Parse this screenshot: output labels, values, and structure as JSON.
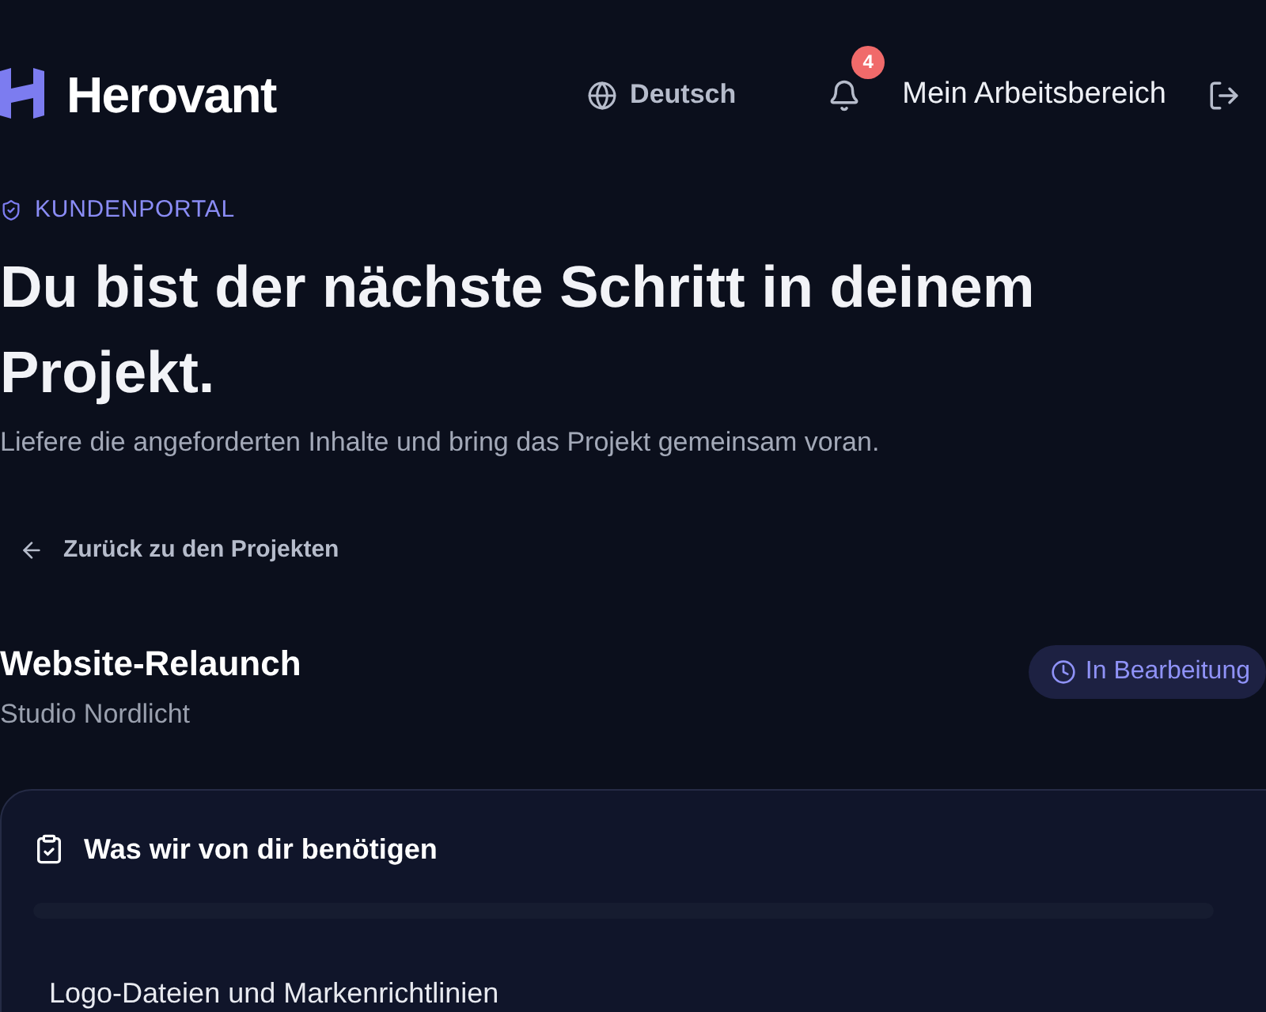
{
  "header": {
    "brand": "Herovant",
    "language": "Deutsch",
    "notifications": {
      "count": "4"
    },
    "workspace": "Mein Arbeitsbereich"
  },
  "intro": {
    "eyebrow": "KUNDENPORTAL",
    "title": "Du bist der nächste Schritt in deinem Projekt.",
    "subtitle": "Liefere die angeforderten Inhalte und bring das Projekt gemeinsam voran."
  },
  "back_link": "Zurück zu den Projekten",
  "project": {
    "name": "Website-Relaunch",
    "client": "Studio Nordlicht",
    "status": "In Bearbeitung"
  },
  "requests": {
    "title": "Was wir von dir benötigen",
    "items": [
      {
        "label": "Logo-Dateien und Markenrichtlinien"
      }
    ]
  }
}
